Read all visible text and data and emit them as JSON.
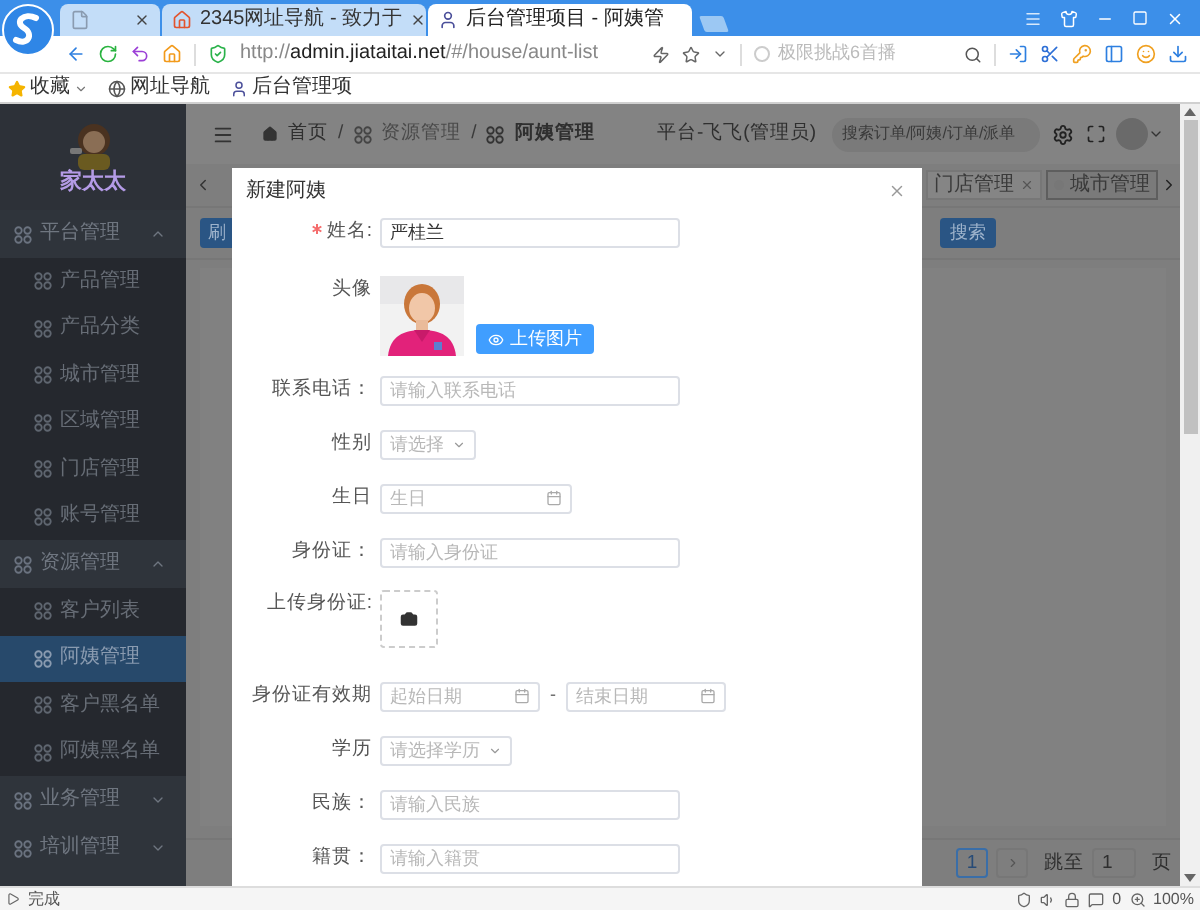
{
  "browser": {
    "tabs": [
      {
        "selected": false,
        "kind": "blank"
      },
      {
        "title": "2345网址导航 - 致力于",
        "selected": false,
        "kind": "site"
      },
      {
        "title": "后台管理项目 - 阿姨管",
        "selected": true,
        "kind": "admin"
      }
    ],
    "url": {
      "scheme": "http://",
      "host": "admin.jiataitai.net",
      "path": "/#/house/aunt-list"
    },
    "search_placeholder": "极限挑战6首播",
    "bookmarks": [
      {
        "label": "收藏",
        "kind": "favorites"
      },
      {
        "label": "网址导航",
        "kind": "globe"
      },
      {
        "label": "后台管理项",
        "kind": "site"
      }
    ]
  },
  "sidebar": {
    "logo_text": "家太太",
    "groups": [
      {
        "label": "平台管理",
        "expanded": true,
        "children": [
          {
            "label": "产品管理",
            "selected": false
          },
          {
            "label": "产品分类",
            "selected": false
          },
          {
            "label": "城市管理",
            "selected": false
          },
          {
            "label": "区域管理",
            "selected": false
          },
          {
            "label": "门店管理",
            "selected": false
          },
          {
            "label": "账号管理",
            "selected": false
          }
        ]
      },
      {
        "label": "资源管理",
        "expanded": true,
        "children": [
          {
            "label": "客户列表",
            "selected": false
          },
          {
            "label": "阿姨管理",
            "selected": true
          },
          {
            "label": "客户黑名单",
            "selected": false
          },
          {
            "label": "阿姨黑名单",
            "selected": false
          }
        ]
      },
      {
        "label": "业务管理",
        "expanded": false
      },
      {
        "label": "培训管理",
        "expanded": false
      }
    ]
  },
  "header": {
    "breadcrumb": [
      "首页",
      "资源管理",
      "阿姨管理"
    ],
    "separator": "/",
    "user": "平台-飞飞(管理员)",
    "search_placeholder": "搜索订单/阿姨/订单/派单"
  },
  "tags": [
    {
      "label": "门店管理",
      "selected": false
    },
    {
      "label": "城市管理",
      "selected": true
    }
  ],
  "toolbar": {
    "left_button": "刷",
    "right_button": "搜索"
  },
  "pagination": {
    "page": "1",
    "goto_label": "跳至",
    "goto_value": "1",
    "page_suffix": "页"
  },
  "dialog": {
    "title": "新建阿姨",
    "fields": [
      {
        "kind": "text",
        "label": "姓名:",
        "required": true,
        "value": "严桂兰"
      },
      {
        "kind": "avatar",
        "label": "头像",
        "required": false,
        "button": "上传图片"
      },
      {
        "kind": "text",
        "label": "联系电话：",
        "required": false,
        "placeholder": "请输入联系电话"
      },
      {
        "kind": "select",
        "label": "性别",
        "required": false,
        "placeholder": "请选择"
      },
      {
        "kind": "date",
        "label": "生日",
        "required": false,
        "placeholder": "生日"
      },
      {
        "kind": "text",
        "label": "身份证：",
        "required": false,
        "placeholder": "请输入身份证"
      },
      {
        "kind": "upload",
        "label": "上传身份证:",
        "required": false
      },
      {
        "kind": "daterange",
        "label": "身份证有效期",
        "required": false,
        "start_placeholder": "起始日期",
        "separator": "-",
        "end_placeholder": "结束日期"
      },
      {
        "kind": "select",
        "label": "学历",
        "required": false,
        "placeholder": "请选择学历"
      },
      {
        "kind": "text",
        "label": "民族：",
        "required": false,
        "placeholder": "请输入民族"
      },
      {
        "kind": "text",
        "label": "籍贯：",
        "required": false,
        "placeholder": "请输入籍贯"
      }
    ]
  },
  "status_bar": {
    "text": "完成",
    "counter": "0",
    "zoom": "100%"
  }
}
